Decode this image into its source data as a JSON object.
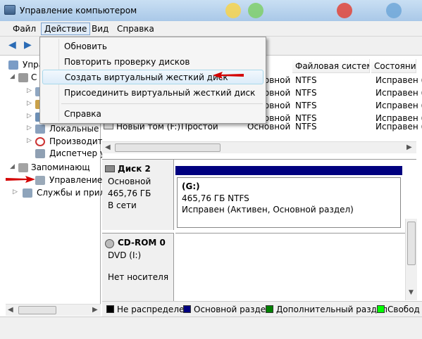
{
  "window": {
    "title": "Управление компьютером"
  },
  "menubar": {
    "file": "Файл",
    "action": "Действие",
    "view": "Вид",
    "help": "Справка"
  },
  "toolbar": {
    "back_icon": "back-arrow-icon",
    "forward_icon": "forward-arrow-icon"
  },
  "dropdown": {
    "items": [
      {
        "label": "Обновить"
      },
      {
        "label": "Повторить проверку дисков"
      },
      {
        "label": "Создать виртуальный жесткий диск"
      },
      {
        "label": "Присоединить виртуальный жесткий диск"
      },
      {
        "label": "Справка"
      }
    ]
  },
  "tree": {
    "items": [
      {
        "label": "Упра"
      },
      {
        "label": "С"
      },
      {
        "label": ""
      },
      {
        "label": ""
      },
      {
        "label": ""
      },
      {
        "label": "Локальные"
      },
      {
        "label": "Производит"
      },
      {
        "label": "Диспетчер у"
      },
      {
        "label": "Запоминающ"
      },
      {
        "label": "Управление"
      },
      {
        "label": "Службы и прил"
      }
    ]
  },
  "volumes": {
    "headers": [
      "Файловая система",
      "Состояние"
    ],
    "rows": [
      {
        "name": "",
        "layout": "",
        "type": "Основной",
        "fs": "NTFS",
        "status": "Исправен ("
      },
      {
        "name": "",
        "layout": "",
        "type": "Основной",
        "fs": "NTFS",
        "status": "Исправен ("
      },
      {
        "name": "",
        "layout": "",
        "type": "Основной",
        "fs": "NTFS",
        "status": "Исправен ("
      },
      {
        "name": "",
        "layout": "",
        "type": "Основной",
        "fs": "NTFS",
        "status": "Исправен ("
      },
      {
        "name": "Новый том (F:)",
        "layout": "Простой",
        "type": "Основной",
        "fs": "NTFS",
        "status": "Исправен ("
      }
    ]
  },
  "disks": {
    "disk2": {
      "name": "Диск 2",
      "type": "Основной",
      "size": "465,76 ГБ",
      "state": "В сети",
      "partition": {
        "label": "(G:)",
        "size_fs": "465,76 ГБ NTFS",
        "status": "Исправен (Активен, Основной раздел)"
      }
    },
    "cdrom": {
      "name": "CD-ROM 0",
      "drive": "DVD (I:)",
      "state": "Нет носителя"
    }
  },
  "legend": {
    "items": [
      {
        "label": "Не распределен",
        "color": "#000000"
      },
      {
        "label": "Основной раздел",
        "color": "#00007f"
      },
      {
        "label": "Дополнительный раздел",
        "color": "#008000"
      },
      {
        "label": "Свобод",
        "color": "#00ff00"
      }
    ]
  },
  "colors": {
    "annotation_arrow": "#d40000",
    "primary_partition": "#00007f"
  }
}
